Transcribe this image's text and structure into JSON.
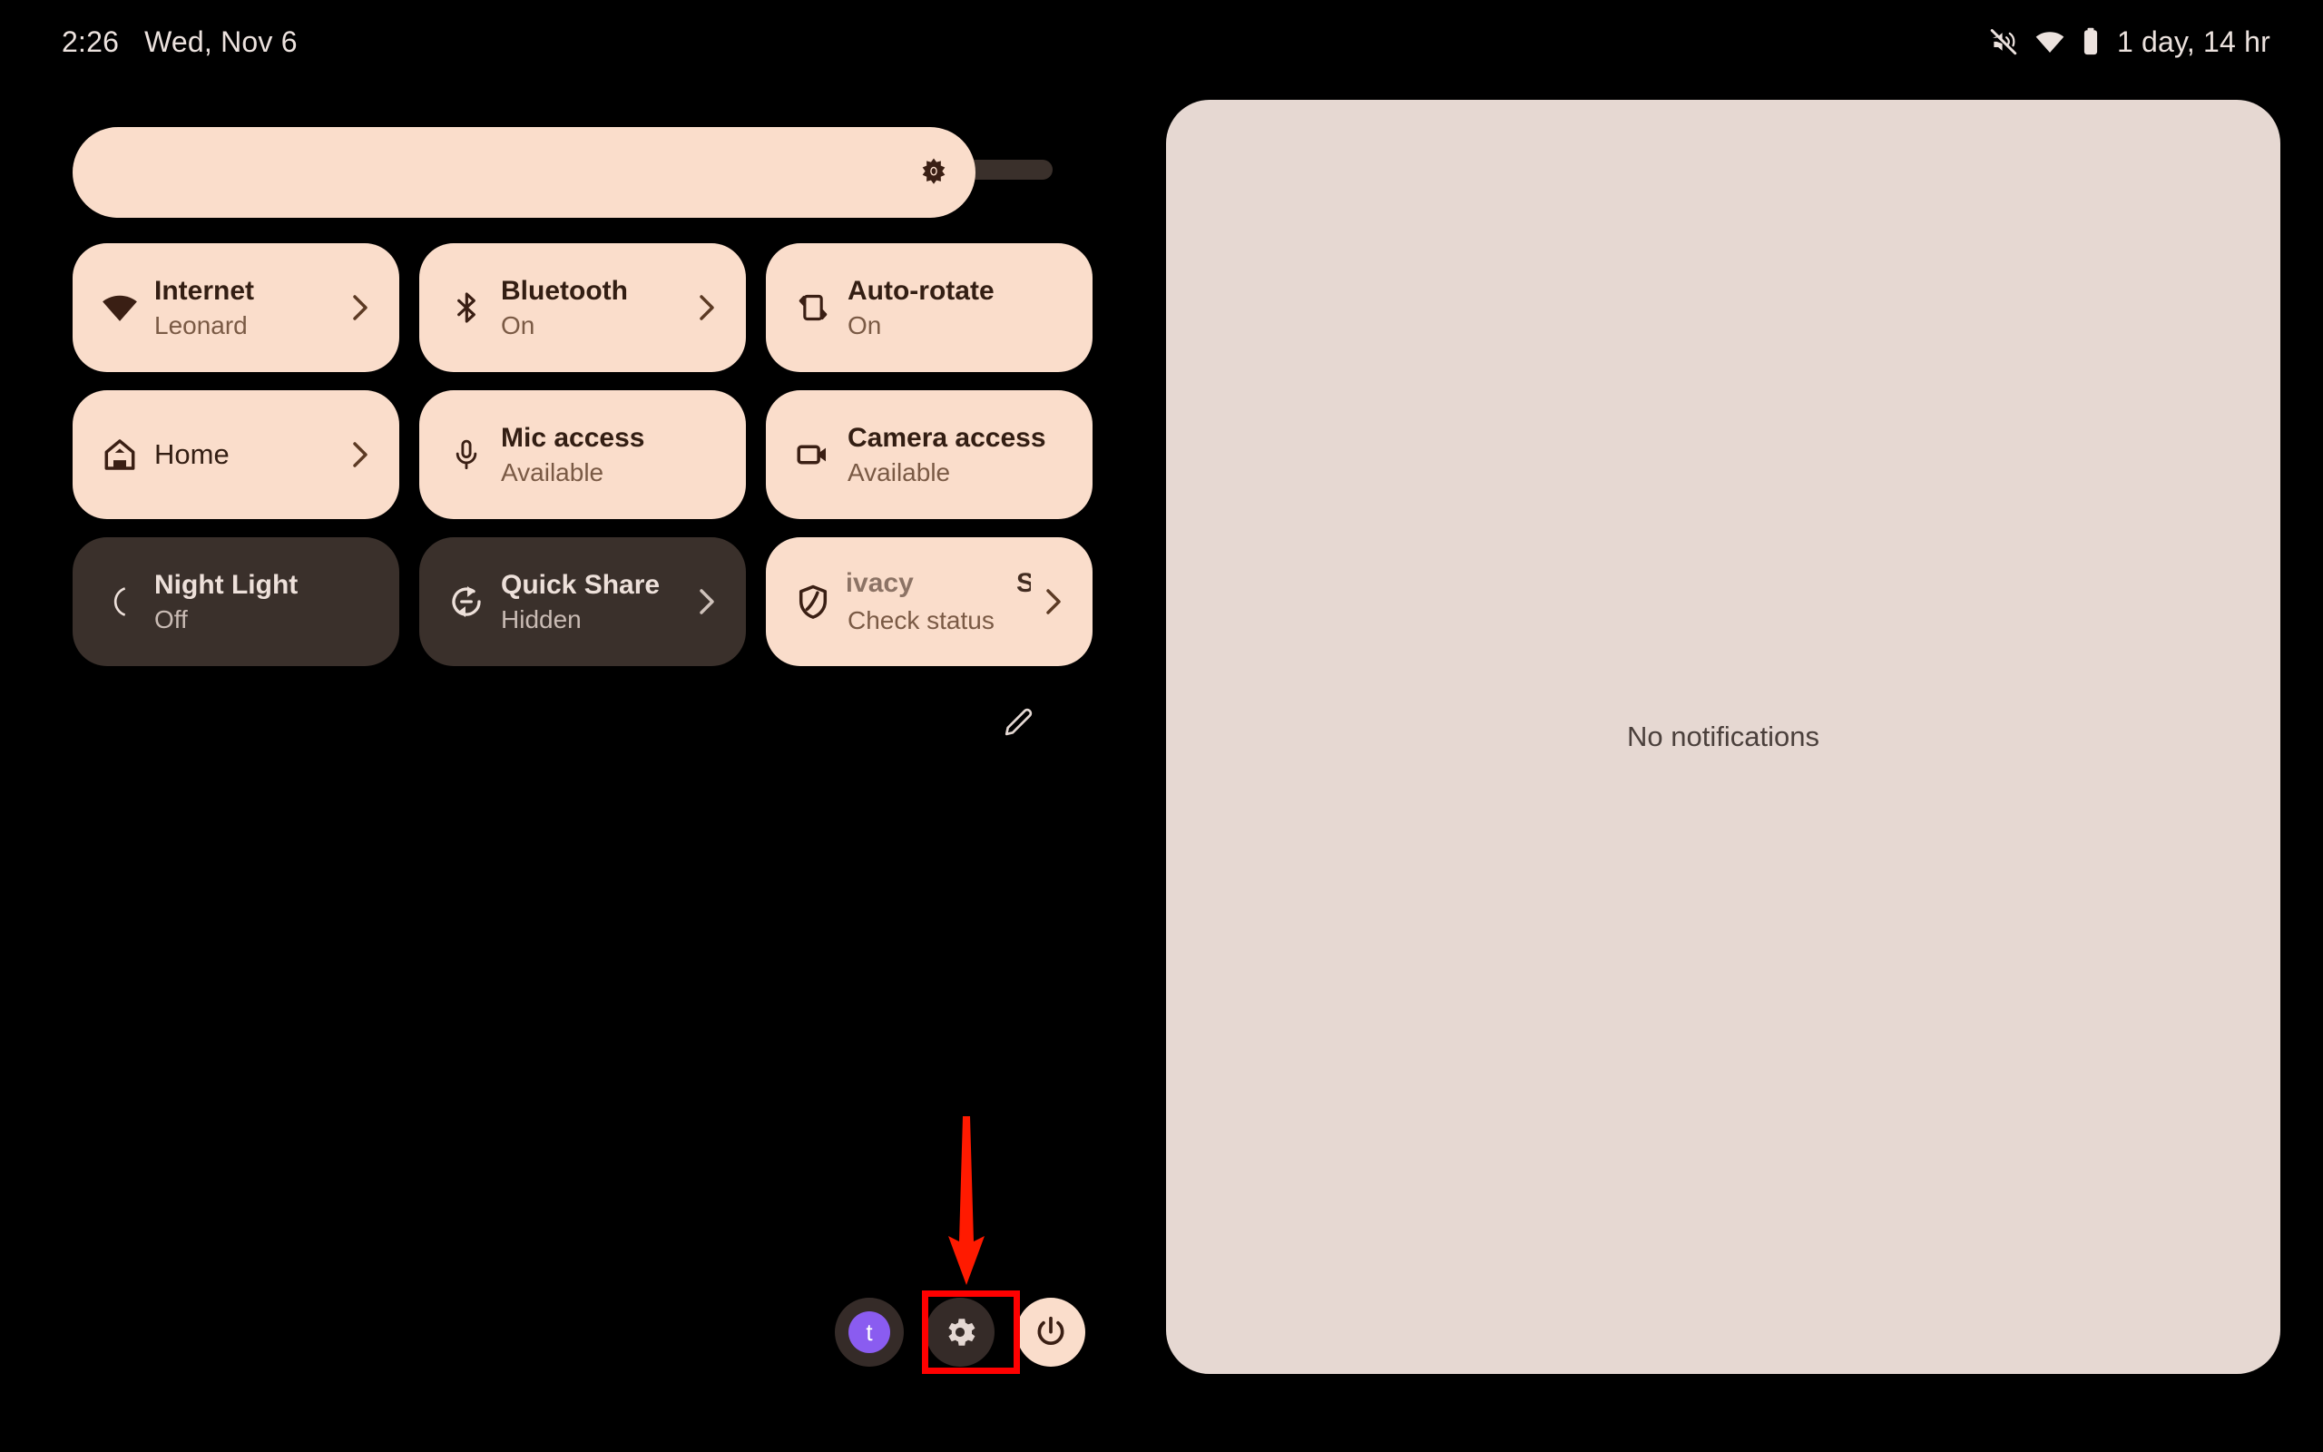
{
  "status_bar": {
    "clock": "2:26",
    "date": "Wed, Nov 6",
    "icons": [
      "volume-off-icon",
      "wifi-icon",
      "battery-icon"
    ],
    "battery_estimate": "1 day, 14 hr"
  },
  "quick_settings": {
    "brightness": {
      "name": "brightness-slider",
      "icon": "brightness-icon",
      "level_percent": 92
    },
    "tiles": [
      {
        "name": "internet",
        "icon": "wifi-icon",
        "title": "Internet",
        "subtitle": "Leonard",
        "state": "on",
        "chevron": true
      },
      {
        "name": "bluetooth",
        "icon": "bluetooth-icon",
        "title": "Bluetooth",
        "subtitle": "On",
        "state": "on",
        "chevron": true
      },
      {
        "name": "auto-rotate",
        "icon": "auto-rotate-icon",
        "title": "Auto-rotate",
        "subtitle": "On",
        "state": "on",
        "chevron": false
      },
      {
        "name": "home",
        "icon": "home-icon",
        "title": "Home",
        "subtitle": "",
        "state": "on",
        "chevron": true
      },
      {
        "name": "mic-access",
        "icon": "microphone-icon",
        "title": "Mic access",
        "subtitle": "Available",
        "state": "on",
        "chevron": false
      },
      {
        "name": "camera-access",
        "icon": "camera-icon",
        "title": "Camera access",
        "subtitle": "Available",
        "state": "on",
        "chevron": false
      },
      {
        "name": "night-light",
        "icon": "moon-icon",
        "title": "Night Light",
        "subtitle": "Off",
        "state": "off",
        "chevron": false
      },
      {
        "name": "quick-share",
        "icon": "quick-share-icon",
        "title": "Quick Share",
        "subtitle": "Hidden",
        "state": "off",
        "chevron": true
      },
      {
        "name": "privacy-security",
        "icon": "shield-icon",
        "title_outgoing": "rivacy",
        "title_incoming": "Se",
        "subtitle": "Check status",
        "state": "on",
        "chevron": true
      }
    ],
    "edit_button_icon": "pencil-icon",
    "footer": {
      "avatar_letter": "t",
      "settings_icon": "gear-icon",
      "power_icon": "power-icon"
    }
  },
  "notifications": {
    "empty_text": "No notifications"
  },
  "annotation": {
    "arrow_color": "#FF0000",
    "highlight_color": "#FF0000",
    "target": "settings-button"
  },
  "colors": {
    "background": "#000000",
    "tile_on": "#FADDCB",
    "tile_off": "#3A302B",
    "tile_on_text": "#331E13",
    "tile_off_text": "#EDE0DA",
    "panel": "#E6D8D2",
    "accent_purple": "#8A5CF0"
  }
}
